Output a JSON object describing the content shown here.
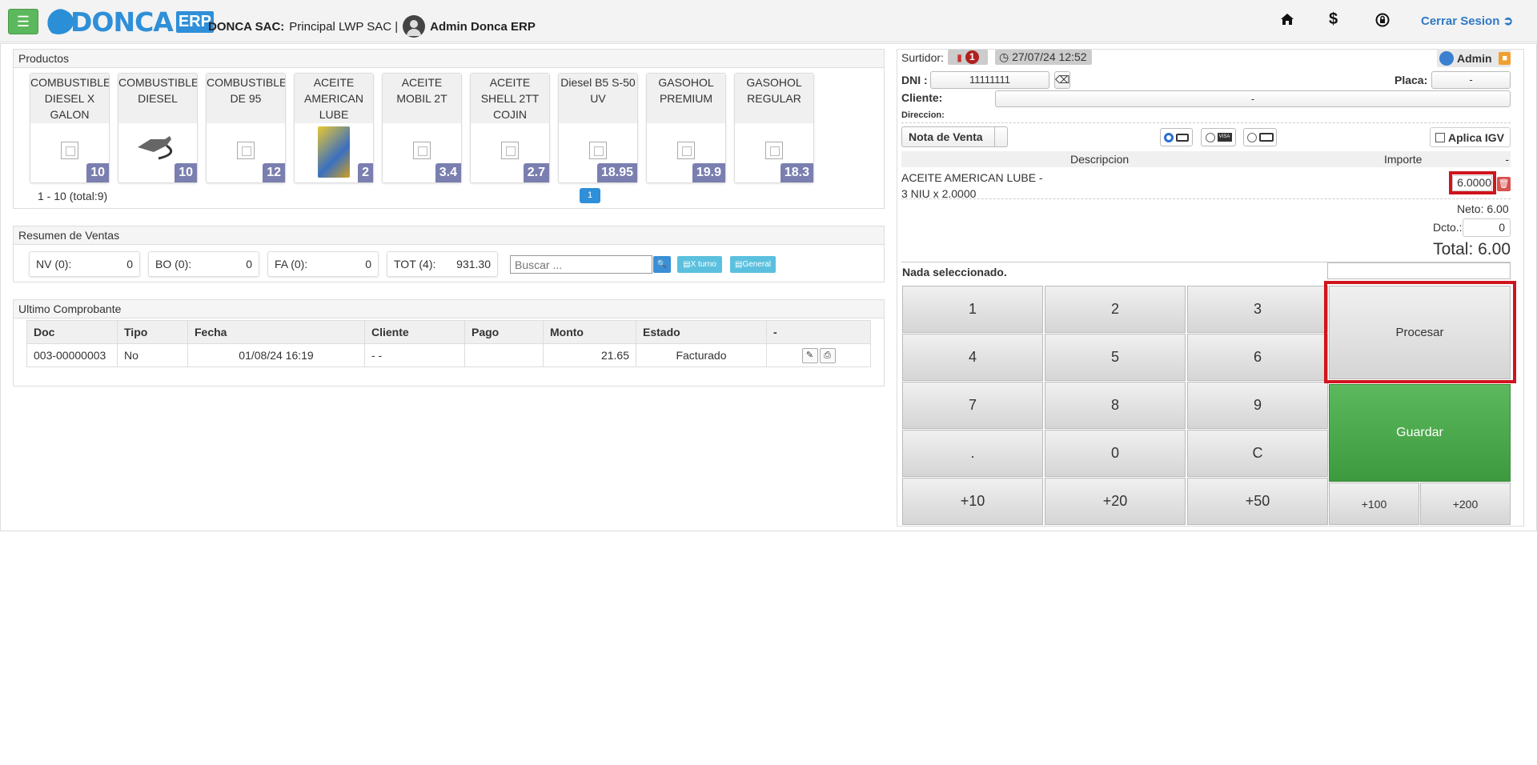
{
  "header": {
    "logo_text": "DONCA",
    "logo_badge": "ERP",
    "company_name": "DONCA SAC:",
    "branch": "Principal LWP SAC |",
    "user": "Admin Donca ERP",
    "icons": [
      "home-icon",
      "dollar-icon",
      "lock-refresh-icon"
    ],
    "logout": "Cerrar Sesion"
  },
  "productos": {
    "title": "Productos",
    "items": [
      {
        "name": "COMBUSTIBLE DIESEL X GALON",
        "price": "10",
        "image": "placeholder"
      },
      {
        "name": "COMBUSTIBLE DIESEL",
        "price": "10",
        "image": "nozzle"
      },
      {
        "name": "COMBUSTIBLE DE 95",
        "price": "12",
        "image": "placeholder"
      },
      {
        "name": "ACEITE AMERICAN LUBE",
        "price": "2",
        "image": "oil-can"
      },
      {
        "name": "ACEITE MOBIL 2T",
        "price": "3.4",
        "image": "placeholder"
      },
      {
        "name": "ACEITE SHELL 2TT COJIN",
        "price": "2.7",
        "image": "placeholder"
      },
      {
        "name": "Diesel B5 S-50 UV",
        "price": "18.95",
        "image": "placeholder"
      },
      {
        "name": "GASOHOL PREMIUM",
        "price": "19.9",
        "image": "placeholder"
      },
      {
        "name": "GASOHOL REGULAR",
        "price": "18.3",
        "image": "placeholder"
      }
    ],
    "pagination_info": "1 - 10 (total:9)",
    "current_page": "1"
  },
  "resumen": {
    "title": "Resumen de Ventas",
    "boxes": [
      {
        "label": "NV (0):",
        "value": "0"
      },
      {
        "label": "BO (0):",
        "value": "0"
      },
      {
        "label": "FA (0):",
        "value": "0"
      },
      {
        "label": "TOT (4):",
        "value": "931.30"
      }
    ],
    "search_placeholder": "Buscar ...",
    "btn_turno": "X turno",
    "btn_general": "General"
  },
  "ultimo": {
    "title": "Ultimo Comprobante",
    "columns": [
      "Doc",
      "Tipo",
      "Fecha",
      "Cliente",
      "Pago",
      "Monto",
      "Estado",
      "-"
    ],
    "rows": [
      {
        "doc": "003-00000003",
        "tipo": "No",
        "fecha": "01/08/24 16:19",
        "cliente": "- -",
        "pago": "",
        "monto": "21.65",
        "estado": "Facturado"
      }
    ]
  },
  "venta": {
    "surtidor_label": "Surtidor:",
    "surtidor_num": "1",
    "datetime": "27/07/24 12:52",
    "user_badge": "Admin",
    "dni_label": "DNI :",
    "dni_value": "11111111",
    "placa_label": "Placa:",
    "placa_value": "-",
    "cliente_label": "Cliente:",
    "cliente_value": "-",
    "direccion_label": "Direccion:",
    "doc_type": "Nota de Venta",
    "payment_options": [
      "cash",
      "visa",
      "card"
    ],
    "payment_selected": "cash",
    "igv_label": "Aplica IGV",
    "col_descripcion": "Descripcion",
    "col_importe": "Importe",
    "col_dash": "-",
    "item_line1": "ACEITE AMERICAN LUBE -",
    "item_line2": "3 NIU x 2.0000",
    "item_importe": "6.0000",
    "neto": "Neto: 6.00",
    "dcto_label": "Dcto.:",
    "dcto_value": "0",
    "total": "Total: 6.00",
    "nada": "Nada seleccionado."
  },
  "keypad": {
    "keys": [
      "1",
      "2",
      "3",
      "4",
      "5",
      "6",
      "7",
      "8",
      "9",
      ".",
      "0",
      "C",
      "+10",
      "+20",
      "+50"
    ],
    "procesar": "Procesar",
    "guardar": "Guardar",
    "plus100": "+100",
    "plus200": "+200"
  },
  "colors": {
    "green": "#4caf50",
    "price_badge": "#7a7fb0",
    "highlight": "#d0141e",
    "link_blue": "#2f78c4"
  }
}
